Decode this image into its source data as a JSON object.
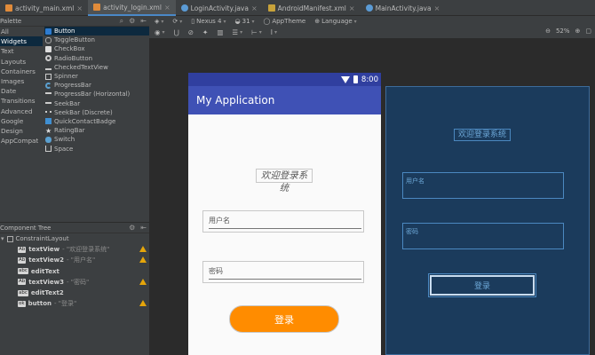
{
  "tabs": [
    {
      "label": "activity_main.xml",
      "icon": "xml",
      "active": false
    },
    {
      "label": "activity_login.xml",
      "icon": "xml",
      "active": true
    },
    {
      "label": "LoginActivity.java",
      "icon": "java",
      "active": false
    },
    {
      "label": "AndroidManifest.xml",
      "icon": "mf",
      "active": false
    },
    {
      "label": "MainActivity.java",
      "icon": "java",
      "active": false
    }
  ],
  "palette": {
    "title": "Palette",
    "categories": [
      "All",
      "Widgets",
      "Text",
      "Layouts",
      "Containers",
      "Images",
      "Date",
      "Transitions",
      "Advanced",
      "Google",
      "Design",
      "AppCompat"
    ],
    "selected_category": "Widgets",
    "widgets": [
      "Button",
      "ToggleButton",
      "CheckBox",
      "RadioButton",
      "CheckedTextView",
      "Spinner",
      "ProgressBar",
      "ProgressBar (Horizontal)",
      "SeekBar",
      "SeekBar (Discrete)",
      "QuickContactBadge",
      "RatingBar",
      "Switch",
      "Space"
    ],
    "selected_widget": "Button"
  },
  "tree": {
    "title": "Component Tree",
    "root": "ConstraintLayout",
    "items": [
      {
        "tag": "Ab",
        "name": "textView",
        "sub": "- \"欢迎登录系统\"",
        "warn": true
      },
      {
        "tag": "Ab",
        "name": "textView2",
        "sub": "- \"用户名\"",
        "warn": true
      },
      {
        "tag": "abc",
        "name": "editText",
        "sub": "",
        "warn": false
      },
      {
        "tag": "Ab",
        "name": "textView3",
        "sub": "- \"密码\"",
        "warn": true
      },
      {
        "tag": "abc",
        "name": "editText2",
        "sub": "",
        "warn": false
      },
      {
        "tag": "ok",
        "name": "button",
        "sub": "- \"登录\"",
        "warn": true
      }
    ]
  },
  "toolbar": {
    "device": "Nexus 4",
    "api": "31",
    "theme": "AppTheme",
    "language": "Language",
    "zoom": "52%"
  },
  "design": {
    "status_time": "8:00",
    "app_title": "My Application",
    "welcome": "欢迎登录系统",
    "username_hint": "用户名",
    "password_hint": "密码",
    "login_label": "登录"
  },
  "colors": {
    "primary": "#3f51b5",
    "primary_dark": "#303f9f",
    "accent_button": "#ff8c00",
    "blueprint_bg": "#1b3b5c",
    "selection": "#0d293e"
  }
}
